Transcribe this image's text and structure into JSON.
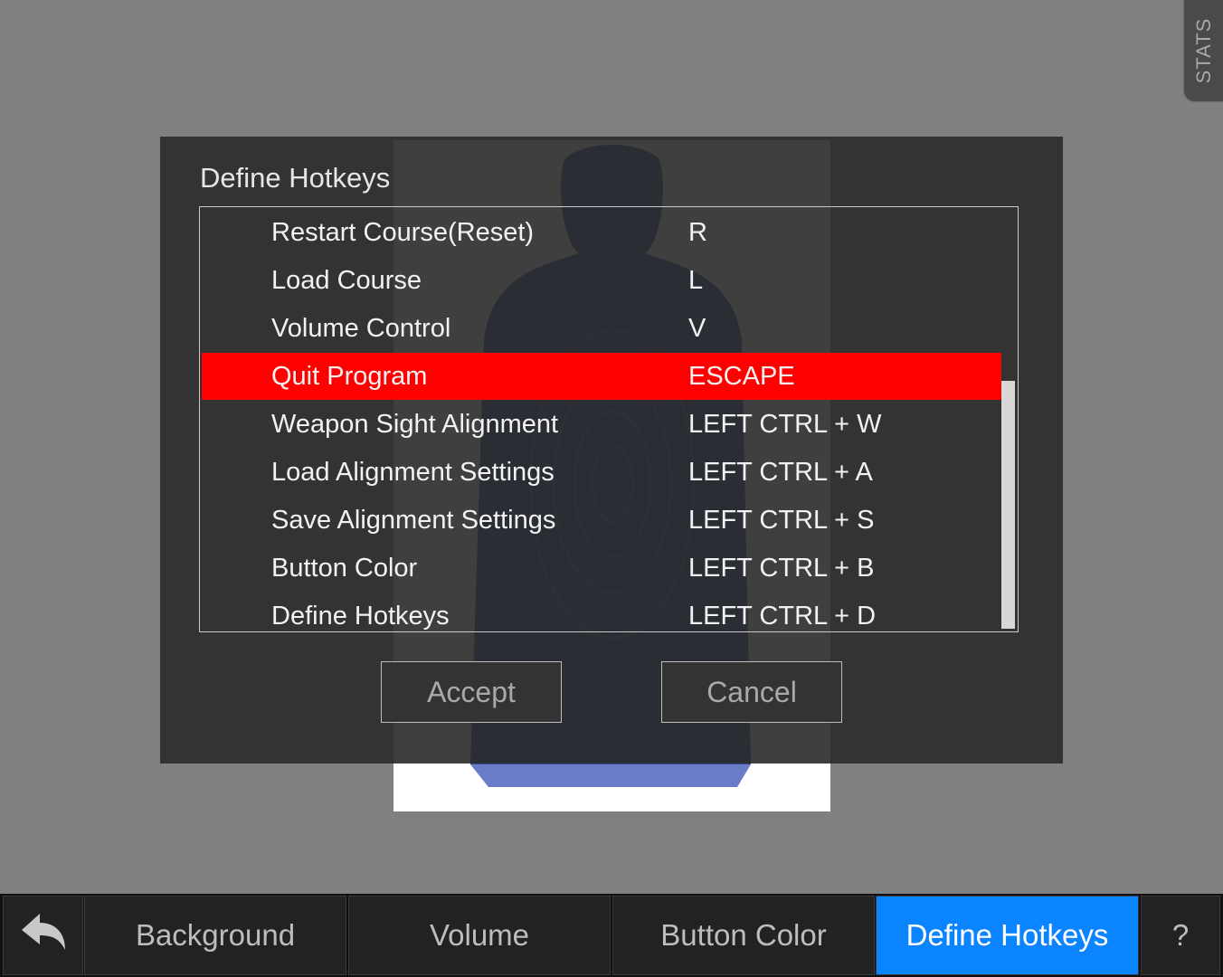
{
  "stats_tab": {
    "label": "STATS"
  },
  "dialog": {
    "title": "Define Hotkeys",
    "hotkeys": [
      {
        "action": "Restart Course(Reset)",
        "key": "R"
      },
      {
        "action": "Load Course",
        "key": "L"
      },
      {
        "action": "Volume Control",
        "key": "V"
      },
      {
        "action": "Quit Program",
        "key": "ESCAPE"
      },
      {
        "action": "Weapon Sight Alignment",
        "key": "LEFT CTRL + W"
      },
      {
        "action": "Load Alignment Settings",
        "key": "LEFT CTRL + A"
      },
      {
        "action": "Save Alignment Settings",
        "key": "LEFT CTRL + S"
      },
      {
        "action": "Button Color",
        "key": "LEFT CTRL + B"
      },
      {
        "action": "Define Hotkeys",
        "key": "LEFT CTRL + D"
      }
    ],
    "selected_index": 3,
    "accept_label": "Accept",
    "cancel_label": "Cancel"
  },
  "toolbar": {
    "back_icon": "back-arrow-icon",
    "background_label": "Background",
    "volume_label": "Volume",
    "button_color_label": "Button Color",
    "define_hotkeys_label": "Define Hotkeys",
    "help_label": "?"
  },
  "colors": {
    "selected_row": "#ff0000",
    "active_tab": "#0a84ff",
    "target_silhouette": "#3a4a8c"
  }
}
